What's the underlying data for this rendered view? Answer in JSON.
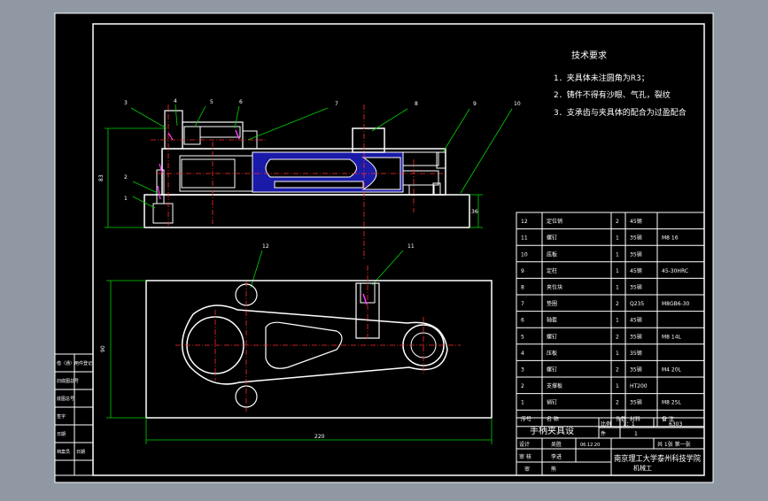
{
  "tech": {
    "title": "技术要求",
    "items": [
      "1．夹具体未注圆角为R3；",
      "2．铸件不得有沙眼、气孔，裂纹",
      "3．支承齿与夹具体的配合为过盈配合"
    ]
  },
  "balloons": [
    "3",
    "4",
    "5",
    "6",
    "7",
    "8",
    "9",
    "10",
    "1",
    "2",
    "12",
    "11"
  ],
  "dims": {
    "height_left": "83",
    "right": "36",
    "width": "220",
    "depth": "90"
  },
  "bom": {
    "rows": [
      [
        "12",
        "定位销",
        "2",
        "45钢",
        ""
      ],
      [
        "11",
        "螺钉",
        "1",
        "35钢",
        "M8 16"
      ],
      [
        "10",
        "底板",
        "1",
        "35钢",
        ""
      ],
      [
        "9",
        "定柱",
        "1",
        "45钢",
        "45-30HRC"
      ],
      [
        "8",
        "夹位块",
        "1",
        "35钢",
        ""
      ],
      [
        "7",
        "垫圈",
        "2",
        "Q235",
        "M8GB6-30"
      ],
      [
        "6",
        "轴套",
        "1",
        "45钢",
        ""
      ],
      [
        "5",
        "螺钉",
        "2",
        "35钢",
        "M8 14L"
      ],
      [
        "4",
        "压板",
        "1",
        "35钢",
        ""
      ],
      [
        "3",
        "螺钉",
        "2",
        "35钢",
        "M4 20L"
      ],
      [
        "2",
        "支撑板",
        "1",
        "HT200",
        ""
      ],
      [
        "1",
        "销钉",
        "2",
        "35钢",
        "M8 25L"
      ]
    ],
    "header": [
      "序号",
      "名 称",
      "件数",
      "材料",
      "备 注"
    ]
  },
  "title_block": {
    "title": "手柄夹具设",
    "scale_label": "比例",
    "scale_value": "1：1",
    "code": "6303",
    "qty_label": "件",
    "qty_value": "1",
    "designer_label": "设计",
    "designer": "吴胜",
    "date": "06.12.20",
    "sheet": "共 1张 第一张",
    "checker_label": "审 核",
    "checker": "李进",
    "approver_label": "审",
    "approver": "熊",
    "school": "南京理工大学泰州科技学院",
    "school_sub": "机械工"
  },
  "side_block": [
    "借（通）用件登记",
    "旧底图总号",
    "底图总号",
    "签字",
    "日期",
    "档案员",
    "日期"
  ]
}
